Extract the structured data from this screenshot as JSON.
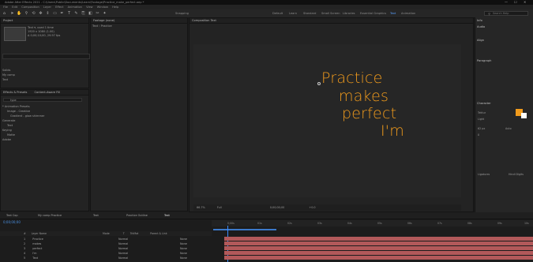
{
  "window": {
    "title": "Adobe After Effects 2021 - C:\\Users\\Public\\Documents\\Learn\\Footage\\Practice_make_perfect.aep *",
    "controls": [
      "—",
      "☐",
      "✕"
    ]
  },
  "menu": [
    "File",
    "Edit",
    "Composition",
    "Layer",
    "Effect",
    "Animation",
    "View",
    "Window",
    "Help"
  ],
  "toolbar": {
    "tools": [
      "home-icon",
      "select-icon",
      "hand-icon",
      "zoom-icon",
      "orbit-icon",
      "pan-icon",
      "dolly-icon",
      "rect-icon",
      "pen-icon",
      "type-icon",
      "brush-icon",
      "clone-icon",
      "eraser-icon",
      "roto-icon",
      "puppet-icon"
    ],
    "snapping": "Snapping",
    "workspaces": [
      "Default",
      "Learn",
      "Standard",
      "Small Screen",
      "Libraries",
      "Essential Graphics",
      "Text",
      "Animation"
    ],
    "active_workspace": "Text",
    "search_placeholder": "Search Help"
  },
  "project_panel": {
    "tab": "Project",
    "preview_name": "Text ▾, used 1 time",
    "preview_dims": "1920 x 1080 (1.00)",
    "preview_dur": "Δ 0;00;10;00, 29.97 fps",
    "items": [
      "Solids",
      "My comp",
      "Text"
    ]
  },
  "effects_panel": {
    "tabs": [
      "Effects & Presets",
      "Content-Aware Fill"
    ],
    "search": "type",
    "items": [
      "* Animation Presets",
      "Image - Creative",
      "Gradient - glow shimmer",
      "Generate",
      "Text",
      "Keying",
      "Matte",
      "Adobe"
    ]
  },
  "viewer": {
    "tab_comp": "Composition Text",
    "tab_footage": "Footage (none)",
    "breadcrumb": "Text ‹ Practice",
    "zoom": "66.7%",
    "resolution": "Full",
    "timecode": "0;00;00;00",
    "footer_extra": "+0.0",
    "text_lines": [
      "Practice",
      "makes",
      "perfect",
      "I'm"
    ]
  },
  "right_panel": {
    "sections": [
      "Info",
      "Audio",
      "Align",
      "Paragraph",
      "Character"
    ],
    "char_font": "Tektur",
    "char_style": "Light",
    "char_size": "62 px",
    "char_leading": "Auto",
    "char_tracking": "0",
    "checks": [
      "Ligatures",
      "Hindi Digits"
    ],
    "fill_color": "#f19b1c"
  },
  "timeline": {
    "tabs": [
      "Text Cop",
      "My comp Practice",
      "Text",
      "Practice Outline",
      "Text"
    ],
    "active_tab": "Text",
    "timecode": "0;00;00;00",
    "columns": [
      "#",
      "Layer Name",
      "Mode",
      "T",
      "TrkMat",
      "Parent & Link"
    ],
    "layers": [
      {
        "num": "1",
        "name": "Practice",
        "mode": "Normal",
        "parent": "None"
      },
      {
        "num": "2",
        "name": "makes",
        "mode": "Normal",
        "parent": "None"
      },
      {
        "num": "3",
        "name": "perfect",
        "mode": "Normal",
        "parent": "None"
      },
      {
        "num": "4",
        "name": "I'm",
        "mode": "Normal",
        "parent": "None"
      },
      {
        "num": "5",
        "name": "Text",
        "mode": "Normal",
        "parent": "None"
      }
    ],
    "ruler": [
      "0;00s",
      "01s",
      "02s",
      "03s",
      "04s",
      "05s",
      "06s",
      "07s",
      "08s",
      "09s",
      "10s"
    ]
  }
}
